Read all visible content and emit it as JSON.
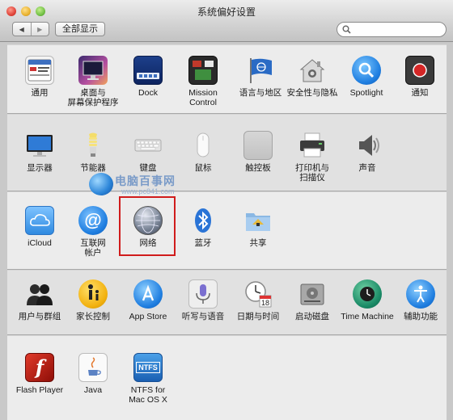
{
  "window": {
    "title": "系统偏好设置"
  },
  "toolbar": {
    "back": "◀",
    "forward": "▶",
    "show_all": "全部显示"
  },
  "search": {
    "placeholder": "",
    "value": ""
  },
  "watermark": {
    "text": "电脑百事网",
    "url": "www.pc841.com"
  },
  "sections": [
    {
      "items": [
        {
          "id": "general",
          "label": "通用",
          "icon": "general-icon"
        },
        {
          "id": "desktop",
          "label": "桌面与\n屏幕保护程序",
          "icon": "desktop-icon"
        },
        {
          "id": "dock",
          "label": "Dock",
          "icon": "dock-icon"
        },
        {
          "id": "mission",
          "label": "Mission\nControl",
          "icon": "mission-control-icon"
        },
        {
          "id": "language",
          "label": "语言与地区",
          "icon": "language-flag-icon"
        },
        {
          "id": "security",
          "label": "安全性与隐私",
          "icon": "security-house-icon"
        },
        {
          "id": "spotlight",
          "label": "Spotlight",
          "icon": "spotlight-icon"
        },
        {
          "id": "notifications",
          "label": "通知",
          "icon": "notifications-icon"
        }
      ]
    },
    {
      "items": [
        {
          "id": "displays",
          "label": "显示器",
          "icon": "display-icon"
        },
        {
          "id": "energy",
          "label": "节能器",
          "icon": "lightbulb-icon"
        },
        {
          "id": "keyboard",
          "label": "键盘",
          "icon": "keyboard-icon"
        },
        {
          "id": "mouse",
          "label": "鼠标",
          "icon": "mouse-icon"
        },
        {
          "id": "trackpad",
          "label": "触控板",
          "icon": "trackpad-icon"
        },
        {
          "id": "printers",
          "label": "打印机与\n扫描仪",
          "icon": "printer-icon"
        },
        {
          "id": "sound",
          "label": "声音",
          "icon": "speaker-icon"
        }
      ]
    },
    {
      "items": [
        {
          "id": "icloud",
          "label": "iCloud",
          "icon": "icloud-icon"
        },
        {
          "id": "internet",
          "label": "互联网\n帐户",
          "icon": "at-sign-icon"
        },
        {
          "id": "network",
          "label": "网络",
          "icon": "network-globe-icon"
        },
        {
          "id": "bluetooth",
          "label": "蓝牙",
          "icon": "bluetooth-icon"
        },
        {
          "id": "sharing",
          "label": "共享",
          "icon": "sharing-folder-icon"
        }
      ]
    },
    {
      "items": [
        {
          "id": "users",
          "label": "用户与群组",
          "icon": "users-icon"
        },
        {
          "id": "parental",
          "label": "家长控制",
          "icon": "parental-controls-icon"
        },
        {
          "id": "appstore",
          "label": "App Store",
          "icon": "app-store-icon"
        },
        {
          "id": "dictation",
          "label": "听写与语音",
          "icon": "microphone-icon"
        },
        {
          "id": "datetime",
          "label": "日期与时间",
          "icon": "clock-calendar-icon"
        },
        {
          "id": "startup",
          "label": "启动磁盘",
          "icon": "hard-disk-icon"
        },
        {
          "id": "timemachine",
          "label": "Time Machine",
          "icon": "time-machine-icon"
        },
        {
          "id": "accessibility",
          "label": "辅助功能",
          "icon": "accessibility-icon"
        }
      ]
    },
    {
      "items": [
        {
          "id": "flash",
          "label": "Flash Player",
          "icon": "flash-icon"
        },
        {
          "id": "java",
          "label": "Java",
          "icon": "java-icon"
        },
        {
          "id": "ntfs",
          "label": "NTFS for\nMac OS X",
          "icon": "ntfs-icon"
        }
      ]
    }
  ],
  "ntfs_icon_text": "NTFS",
  "calendar_icon_text": "18",
  "highlighted_item": "network",
  "colors": {
    "highlight": "#d01c1c"
  }
}
